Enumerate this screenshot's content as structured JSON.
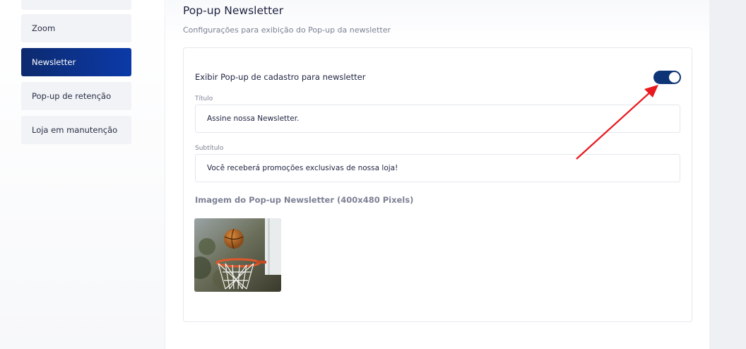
{
  "sidebar": {
    "items": [
      {
        "label": ""
      },
      {
        "label": "Zoom"
      },
      {
        "label": "Newsletter"
      },
      {
        "label": "Pop-up de retenção"
      },
      {
        "label": "Loja em manutenção"
      }
    ]
  },
  "section": {
    "title": "Pop-up Newsletter",
    "subtitle": "Configurações para exibição do Pop-up da newsletter"
  },
  "form": {
    "toggle_label": "Exibir Pop-up de cadastro para newsletter",
    "toggle_on": true,
    "title_label": "Título",
    "title_value": "Assine nossa Newsletter.",
    "subtitle_label": "Subtítulo",
    "subtitle_value": "Você receberá promoções exclusivas de nossa loja!",
    "image_label": "Imagem do Pop-up Newsletter (400x480 Pixels)"
  },
  "colors": {
    "accent": "#0e3478",
    "arrow": "#e8191f"
  }
}
